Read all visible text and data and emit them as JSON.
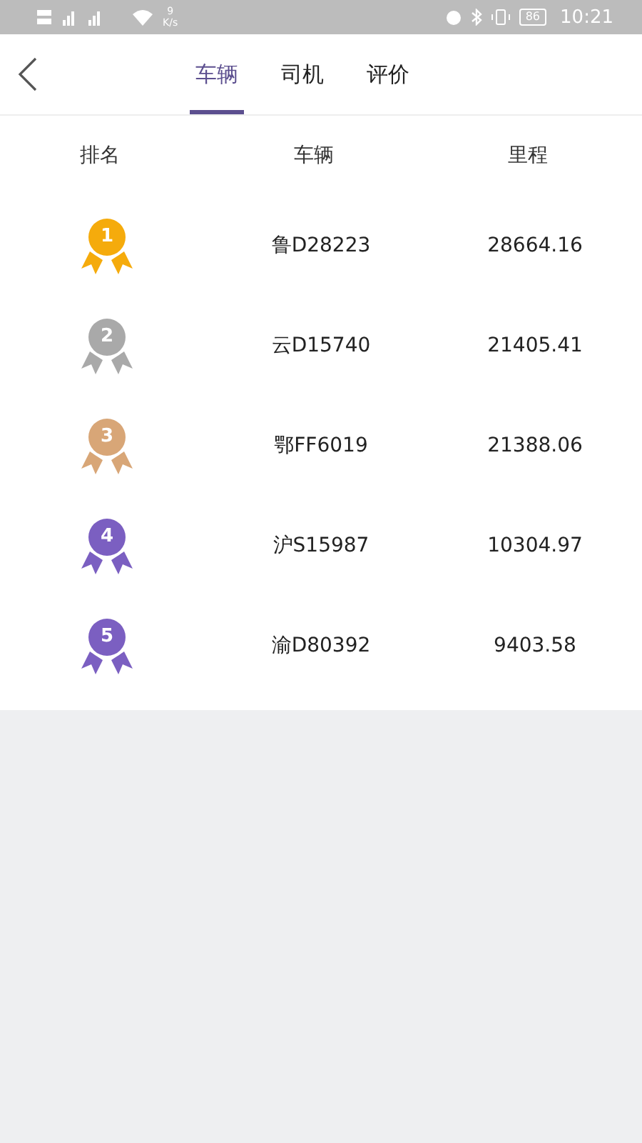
{
  "status_bar": {
    "speed_value": "9",
    "speed_unit": "K/s",
    "battery": "86",
    "time": "10:21"
  },
  "tabs": [
    {
      "label": "车辆",
      "selected": true
    },
    {
      "label": "司机",
      "selected": false
    },
    {
      "label": "评价",
      "selected": false
    }
  ],
  "table": {
    "columns": [
      "排名",
      "车辆",
      "里程"
    ],
    "rows": [
      {
        "rank": "1",
        "color": "#f5ab0c",
        "vehicle": "鲁D28223",
        "mileage": "28664.16"
      },
      {
        "rank": "2",
        "color": "#a9a9a9",
        "vehicle": "云D15740",
        "mileage": "21405.41"
      },
      {
        "rank": "3",
        "color": "#d8a677",
        "vehicle": "鄂FF6019",
        "mileage": "21388.06"
      },
      {
        "rank": "4",
        "color": "#7b5fc1",
        "vehicle": "沪S15987",
        "mileage": "10304.97"
      },
      {
        "rank": "5",
        "color": "#7b5fc1",
        "vehicle": "渝D80392",
        "mileage": "9403.58"
      }
    ]
  }
}
